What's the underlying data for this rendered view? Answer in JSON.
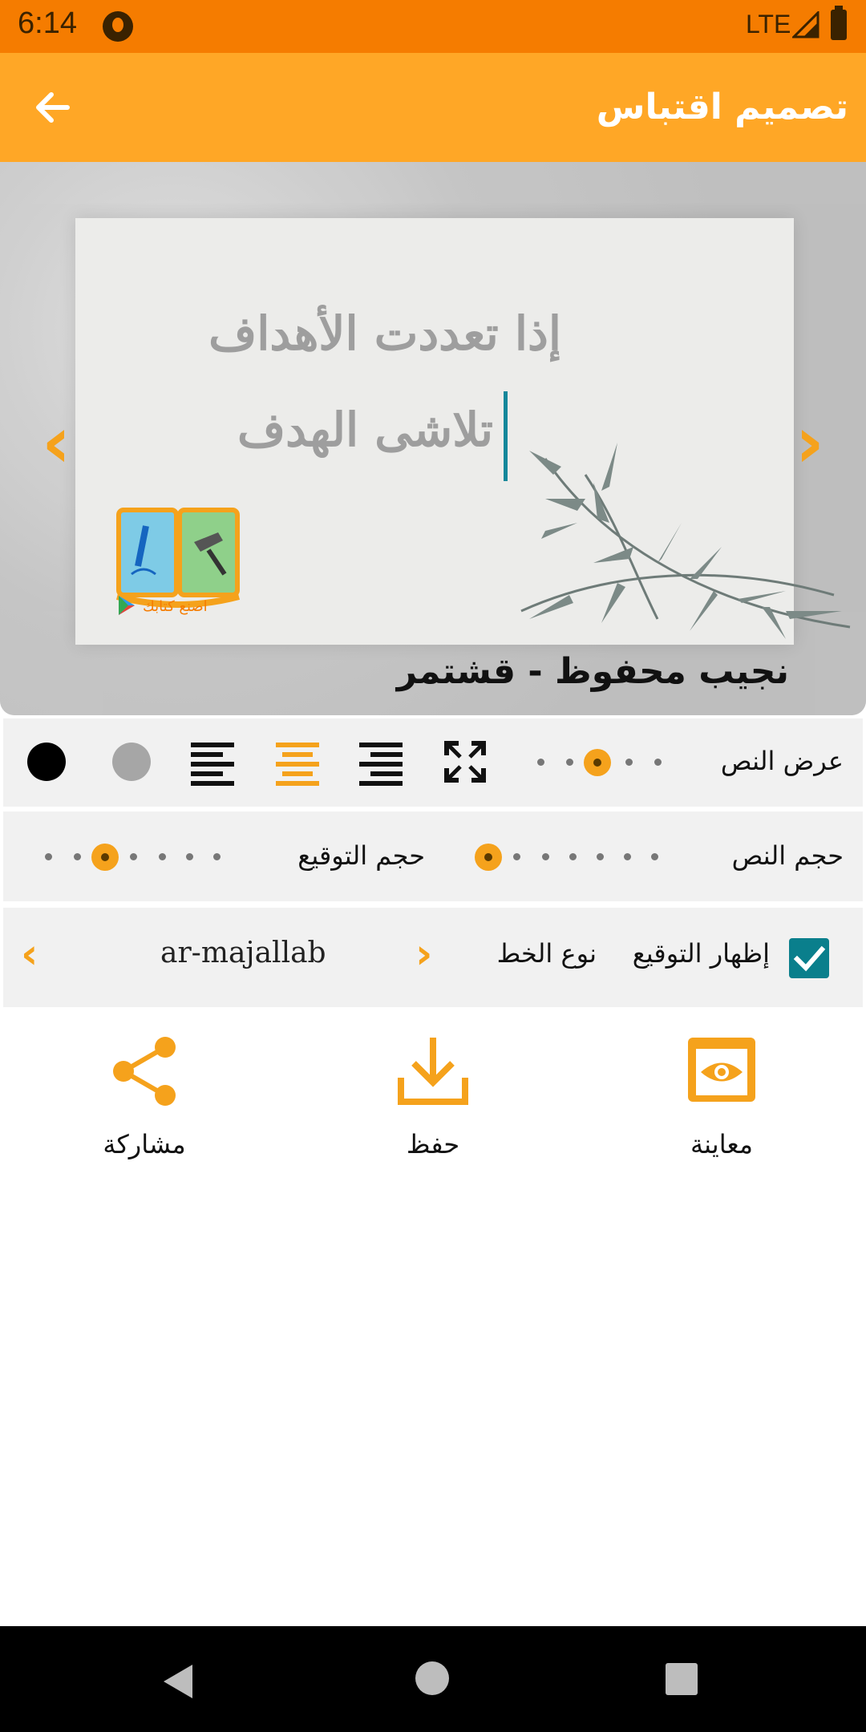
{
  "status_bar": {
    "time": "6:14",
    "network": "LTE"
  },
  "app_bar": {
    "title": "تصميم اقتباس",
    "back_icon": "arrow-back-icon"
  },
  "preview": {
    "quote_line_1": "إذا تعددت الأهداف",
    "quote_line_2": "تلاشى الهدف",
    "signature": "نجيب محفوظ - قشتمر",
    "logo_caption": "اصنع كتابك",
    "prev_icon": "chevron-left-icon",
    "next_icon": "chevron-right-icon"
  },
  "controls": {
    "text_width_label": "عرض النص",
    "text_width_selected": 3,
    "text_width_steps": 5,
    "alignment_selected": "center",
    "text_color_options": [
      "#000000",
      "#a6a6a6"
    ],
    "text_size_label": "حجم النص",
    "text_size_selected": 1,
    "text_size_steps": 7,
    "signature_size_label": "حجم التوقيع",
    "signature_size_selected": 3,
    "signature_size_steps": 7,
    "show_signature_label": "إظهار التوقيع",
    "show_signature_checked": true,
    "font_type_label": "نوع الخط",
    "font_name": "ar-majallab"
  },
  "actions": {
    "preview_label": "معاينة",
    "save_label": "حفظ",
    "share_label": "مشاركة"
  },
  "colors": {
    "accent": "#ffa726",
    "status": "#f57c00",
    "checkbox": "#0a7f8c"
  }
}
